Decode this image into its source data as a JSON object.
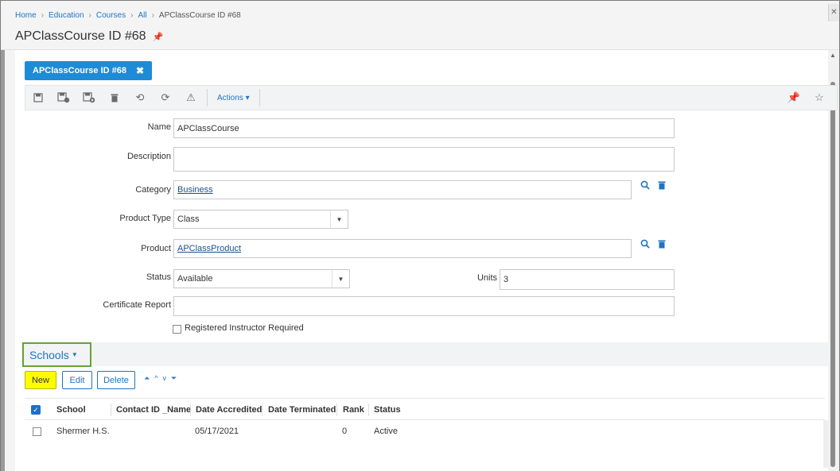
{
  "breadcrumb": {
    "items": [
      "Home",
      "Education",
      "Courses",
      "All",
      "APClassCourse ID #68"
    ]
  },
  "page": {
    "title": "APClassCourse ID #68"
  },
  "tab": {
    "label": "APClassCourse ID #68"
  },
  "toolbar": {
    "actions_label": "Actions ▾"
  },
  "form": {
    "name_label": "Name",
    "name_value": "APClassCourse",
    "description_label": "Description",
    "description_value": "",
    "category_label": "Category",
    "category_value": "Business",
    "product_type_label": "Product Type",
    "product_type_value": "Class",
    "product_label": "Product",
    "product_value": "APClassProduct",
    "status_label": "Status",
    "status_value": "Available",
    "units_label": "Units",
    "units_value": "3",
    "certificate_label": "Certificate Report",
    "certificate_value": "",
    "registered_label": "Registered Instructor Required"
  },
  "schools": {
    "title": "Schools",
    "buttons": {
      "new": "New",
      "edit": "Edit",
      "delete": "Delete"
    },
    "columns": [
      "School",
      "Contact ID _Name",
      "Date Accredited",
      "Date Terminated",
      "Rank",
      "Status"
    ],
    "rows": [
      {
        "school": "Shermer H.S.",
        "contact": "",
        "accredited": "05/17/2021",
        "terminated": "",
        "rank": "0",
        "status": "Active"
      }
    ]
  }
}
